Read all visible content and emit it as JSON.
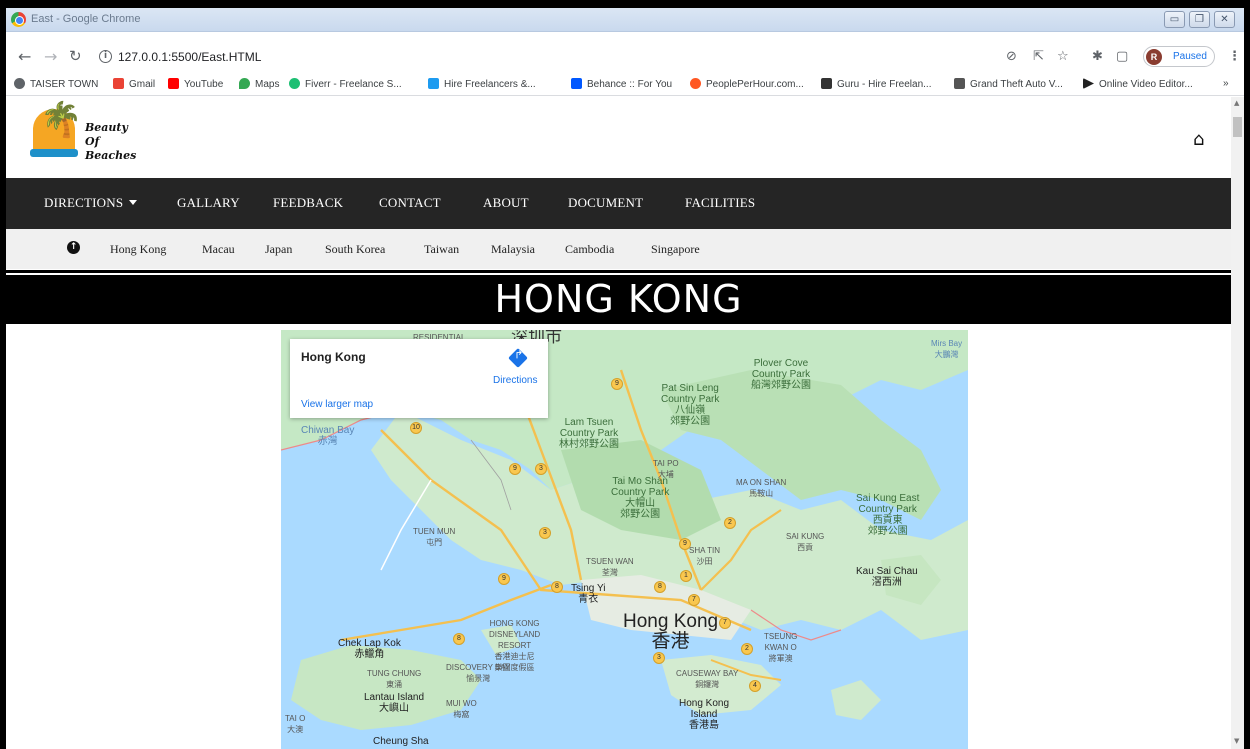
{
  "window": {
    "title": "East - Google Chrome"
  },
  "addressbar": {
    "url": "127.0.0.1:5500/East.HTML",
    "profile_initial": "R",
    "profile_status": "Paused"
  },
  "bookmarks": [
    {
      "label": "TAISER TOWN",
      "color": "#5f6368"
    },
    {
      "label": "Gmail",
      "color": "#ea4335"
    },
    {
      "label": "YouTube",
      "color": "#ff0000"
    },
    {
      "label": "Maps",
      "color": "#34a853"
    },
    {
      "label": "Fiverr - Freelance S...",
      "color": "#1dbf73"
    },
    {
      "label": "Hire Freelancers &...",
      "color": "#1d9bf0"
    },
    {
      "label": "Behance :: For You",
      "color": "#0057ff"
    },
    {
      "label": "PeoplePerHour.com...",
      "color": "#ff5722"
    },
    {
      "label": "Guru - Hire Freelan...",
      "color": "#333333"
    },
    {
      "label": "Grand Theft Auto V...",
      "color": "#555555"
    },
    {
      "label": "Online Video Editor...",
      "color": "#222222"
    }
  ],
  "bookmarks_more": "»",
  "site": {
    "logo_line1": "Beauty Of",
    "logo_line2": "Beaches",
    "mainnav": [
      "DIRECTIONS",
      "GALLARY",
      "FEEDBACK",
      "CONTACT",
      "ABOUT",
      "DOCUMENT",
      "FACILITIES"
    ],
    "subnav": [
      "Hong Kong",
      "Macau",
      "Japan",
      "South Korea",
      "Taiwan",
      "Malaysia",
      "Cambodia",
      "Singapore"
    ],
    "banner": "HONG KONG"
  },
  "map": {
    "card_title": "Hong Kong",
    "directions": "Directions",
    "larger_map": "View larger map",
    "labels": {
      "shenzhen": "深圳市",
      "residential": "RESIDENTIAL",
      "plover": "Plover Cove\nCountry Park\n船灣郊野公園",
      "mirs": "Mirs Bay\n大鵬灣",
      "pat_sin": "Pat Sin Leng\nCountry Park\n八仙嶺\n郊野公園",
      "lam_tsuen": "Lam Tsuen\nCountry Park\n林村郊野公園",
      "chiwan": "Chiwan Bay\n赤灣",
      "tai_po": "TAI PO\n大埔",
      "tai_mo_shan": "Tai Mo Shan\nCountry Park\n大帽山\n郊野公園",
      "ma_on_shan": "MA ON SHAN\n馬鞍山",
      "sai_kung_east": "Sai Kung East\nCountry Park\n西貢東\n郊野公園",
      "tuen_mun": "TUEN MUN\n屯門",
      "sai_kung": "SAI KUNG\n西貢",
      "sha_tin": "SHA TIN\n沙田",
      "kau_sai_chau": "Kau Sai Chau\n滘西洲",
      "tsuen_wan": "TSUEN WAN\n荃灣",
      "tsing_yi": "Tsing Yi\n青衣",
      "hong_kong": "Hong Kong\n香港",
      "disneyland": "HONG KONG\nDISNEYLAND\nRESORT\n香港迪士尼\n樂園度假區",
      "chek_lap_kok": "Chek Lap Kok\n赤鱲角",
      "tseung_kwan_o": "TSEUNG\nKWAN O\n將軍澳",
      "discovery_bay": "DISCOVERY BAY\n愉景灣",
      "tung_chung": "TUNG CHUNG\n東涌",
      "causeway_bay": "CAUSEWAY BAY\n銅鑼灣",
      "lantau": "Lantau Island\n大嶼山",
      "mui_wo": "MUI WO\n梅窩",
      "hk_island": "Hong Kong\nIsland\n香港島",
      "tai_o": "TAI O\n大澳",
      "cheung_sha": "Cheung Sha"
    },
    "routes": [
      "9",
      "10",
      "9",
      "3",
      "3",
      "9",
      "8",
      "8",
      "9",
      "7",
      "2",
      "2",
      "4",
      "3",
      "8",
      "1",
      "7"
    ]
  }
}
